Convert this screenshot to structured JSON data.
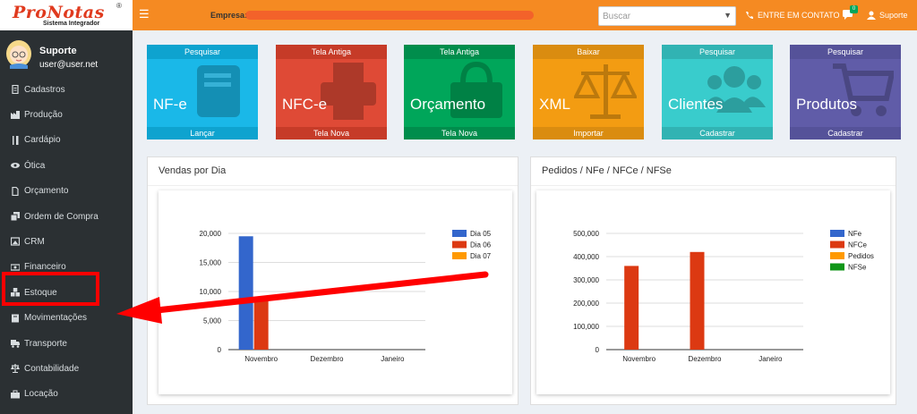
{
  "app": {
    "logo": "ProNotas",
    "logo_reg": "®",
    "logo_sub": "Sistema Integrador"
  },
  "topbar": {
    "empresa_label": "Empresa:",
    "search_placeholder": "Buscar",
    "contact_label": "ENTRE EM CONTATO",
    "chat_badge": "0",
    "user_label": "Suporte"
  },
  "user": {
    "name": "Suporte",
    "email": "user@user.net"
  },
  "sidebar": {
    "items": [
      {
        "label": "Cadastros",
        "icon": "document-icon"
      },
      {
        "label": "Produção",
        "icon": "factory-icon"
      },
      {
        "label": "Cardápio",
        "icon": "utensils-icon"
      },
      {
        "label": "Ótica",
        "icon": "eye-icon"
      },
      {
        "label": "Orçamento",
        "icon": "file-icon"
      },
      {
        "label": "Ordem de Compra",
        "icon": "copy-icon"
      },
      {
        "label": "CRM",
        "icon": "image-icon"
      },
      {
        "label": "Financeiro",
        "icon": "money-icon"
      },
      {
        "label": "Estoque",
        "icon": "cubes-icon"
      },
      {
        "label": "Movimentações",
        "icon": "book-icon"
      },
      {
        "label": "Transporte",
        "icon": "truck-icon"
      },
      {
        "label": "Contabilidade",
        "icon": "balance-icon"
      },
      {
        "label": "Locação",
        "icon": "briefcase-icon"
      }
    ]
  },
  "tiles": [
    {
      "top": "Pesquisar",
      "main": "NF-e",
      "bottom": "Lançar",
      "color": "#1ab8e8",
      "bar": "#0ea3cf",
      "icon": "book-icon"
    },
    {
      "top": "Tela Antiga",
      "main": "NFC-e",
      "bottom": "Tela Nova",
      "color": "#df4a36",
      "bar": "#c63b28",
      "icon": "printer-icon"
    },
    {
      "top": "Tela Antiga",
      "main": "Orçamento",
      "bottom": "Tela Nova",
      "color": "#00a65a",
      "bar": "#008d4c",
      "icon": "shopping-bag-icon"
    },
    {
      "top": "Baixar",
      "main": "XML",
      "bottom": "Importar",
      "color": "#f39c12",
      "bar": "#da8c10",
      "icon": "balance-scale-icon"
    },
    {
      "top": "Pesquisar",
      "main": "Clientes",
      "bottom": "Cadastrar",
      "color": "#39cccc",
      "bar": "#31b3b3",
      "icon": "users-icon"
    },
    {
      "top": "Pesquisar",
      "main": "Produtos",
      "bottom": "Cadastrar",
      "color": "#605ca8",
      "bar": "#555299",
      "icon": "cart-icon"
    }
  ],
  "panels": {
    "vendas_title": "Vendas por Dia",
    "pedidos_title": "Pedidos / NFe / NFCe / NFSe"
  },
  "chart_data": [
    {
      "type": "bar",
      "categories": [
        "Novembro",
        "Dezembro",
        "Janeiro"
      ],
      "series": [
        {
          "name": "Dia 05",
          "color": "#3366cc",
          "values": [
            19500,
            0,
            0
          ]
        },
        {
          "name": "Dia 06",
          "color": "#dc3912",
          "values": [
            8500,
            0,
            0
          ]
        },
        {
          "name": "Dia 07",
          "color": "#ff9900",
          "values": [
            0,
            0,
            0
          ]
        }
      ],
      "yticks": [
        "0",
        "5,000",
        "10,000",
        "15,000",
        "20,000"
      ],
      "ylim": [
        0,
        20000
      ],
      "grid": true,
      "legend": "right"
    },
    {
      "type": "bar",
      "categories": [
        "Novembro",
        "Dezembro",
        "Janeiro"
      ],
      "series": [
        {
          "name": "NFe",
          "color": "#3366cc",
          "values": [
            0,
            0,
            0
          ]
        },
        {
          "name": "NFCe",
          "color": "#dc3912",
          "values": [
            360000,
            420000,
            0
          ]
        },
        {
          "name": "Pedidos",
          "color": "#ff9900",
          "values": [
            0,
            0,
            0
          ]
        },
        {
          "name": "NFSe",
          "color": "#109618",
          "values": [
            0,
            0,
            0
          ]
        }
      ],
      "yticks": [
        "0",
        "100,000",
        "200,000",
        "300,000",
        "400,000",
        "500,000"
      ],
      "ylim": [
        0,
        500000
      ],
      "grid": true,
      "legend": "right"
    }
  ]
}
